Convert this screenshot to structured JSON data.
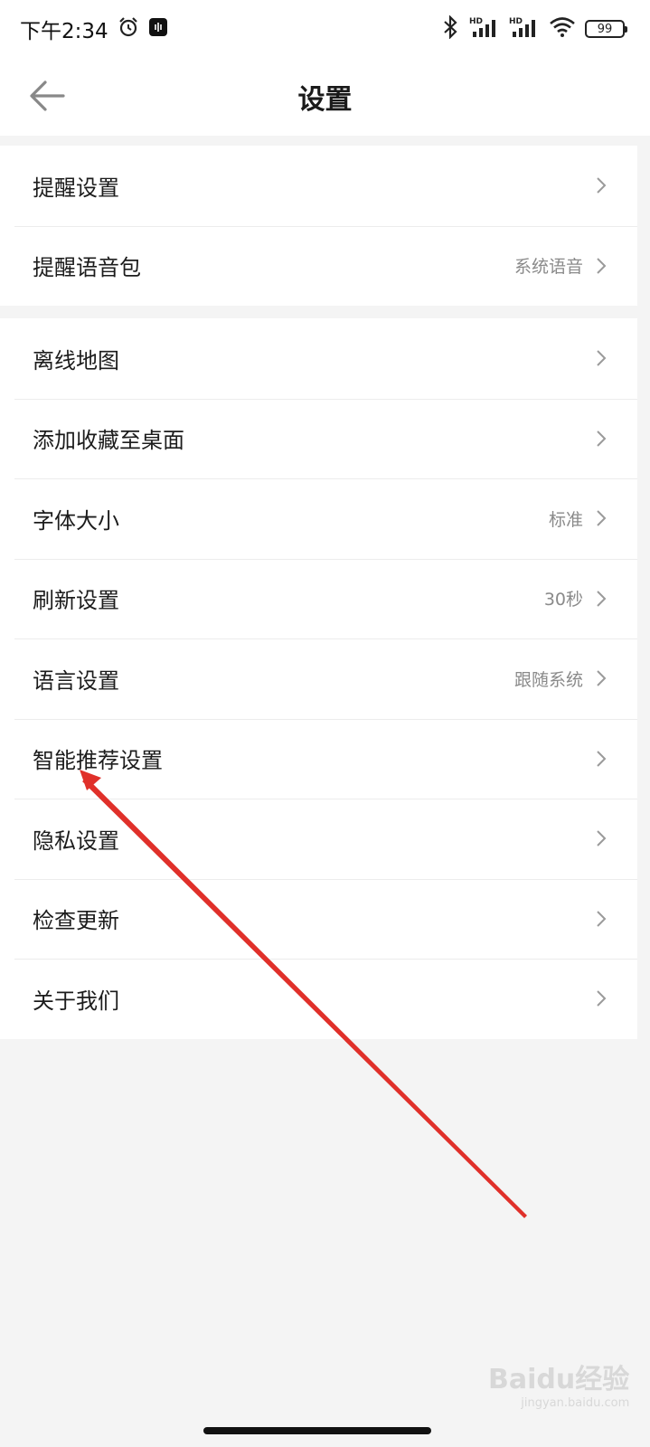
{
  "status_bar": {
    "time": "下午2:34",
    "battery": "99",
    "network_labels": [
      "HD",
      "HD"
    ]
  },
  "header": {
    "title": "设置"
  },
  "groups": [
    {
      "items": [
        {
          "label": "提醒设置",
          "value": ""
        },
        {
          "label": "提醒语音包",
          "value": "系统语音"
        }
      ]
    },
    {
      "items": [
        {
          "label": "离线地图",
          "value": ""
        },
        {
          "label": "添加收藏至桌面",
          "value": ""
        },
        {
          "label": "字体大小",
          "value": "标准"
        },
        {
          "label": "刷新设置",
          "value": "30秒"
        },
        {
          "label": "语言设置",
          "value": "跟随系统"
        },
        {
          "label": "智能推荐设置",
          "value": ""
        },
        {
          "label": "隐私设置",
          "value": ""
        },
        {
          "label": "检查更新",
          "value": ""
        },
        {
          "label": "关于我们",
          "value": ""
        }
      ]
    }
  ],
  "watermark": {
    "brand": "Baidu经验",
    "url": "jingyan.baidu.com"
  },
  "colors": {
    "annotation_arrow": "#e0302a",
    "background": "#f4f4f4",
    "secondary_text": "#8a8a8a"
  }
}
